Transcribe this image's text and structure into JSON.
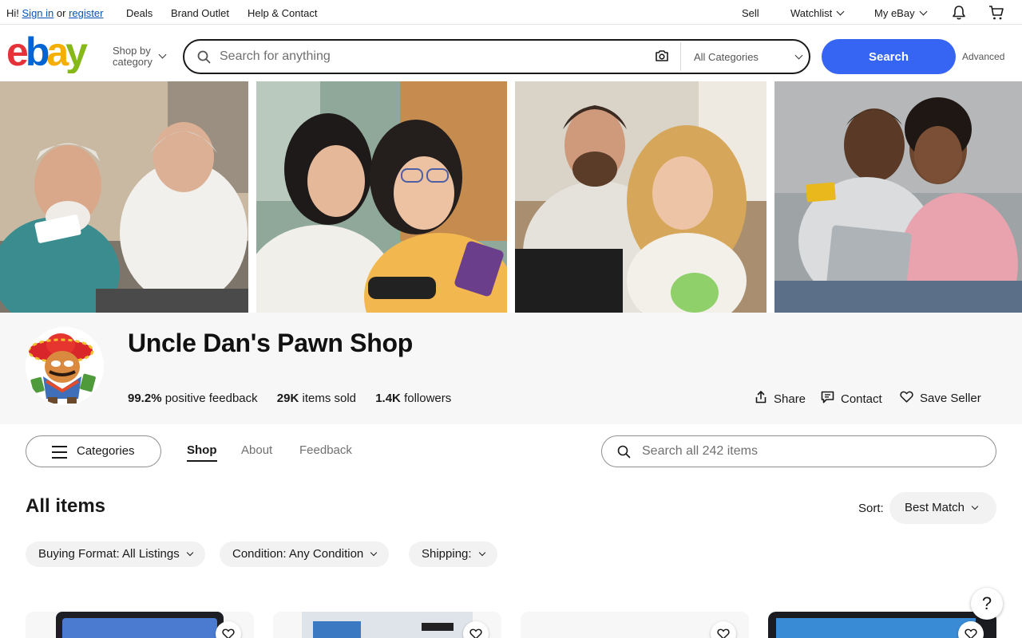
{
  "topbar": {
    "greeting": "Hi!",
    "sign_in": "Sign in",
    "or": "or",
    "register": "register",
    "deals": "Deals",
    "brand_outlet": "Brand Outlet",
    "help_contact": "Help & Contact",
    "sell": "Sell",
    "watchlist": "Watchlist",
    "my_ebay": "My eBay"
  },
  "header": {
    "logo_text": "ebay",
    "shop_by_line1": "Shop by",
    "shop_by_line2": "category",
    "search_placeholder": "Search for anything",
    "category_select": "All Categories",
    "search_button": "Search",
    "advanced": "Advanced"
  },
  "icons": {
    "search": "search-icon",
    "camera": "camera-icon",
    "bell": "bell-icon",
    "cart": "cart-icon",
    "share": "share-icon",
    "contact": "message-icon",
    "save": "heart-icon",
    "help": "help-icon"
  },
  "colors": {
    "ebay_red": "#e53238",
    "ebay_blue": "#0064d2",
    "ebay_yellow": "#f5af02",
    "ebay_green": "#86b817",
    "search_button": "#3665f3",
    "link": "#0654ba"
  },
  "store": {
    "name": "Uncle Dan's Pawn Shop",
    "feedback_value": "99.2%",
    "feedback_label": "positive feedback",
    "sold_value": "29K",
    "sold_label": "items sold",
    "followers_value": "1.4K",
    "followers_label": "followers",
    "share": "Share",
    "contact": "Contact",
    "save_seller": "Save Seller"
  },
  "store_nav": {
    "categories": "Categories",
    "tabs": [
      {
        "label": "Shop",
        "active": true
      },
      {
        "label": "About",
        "active": false
      },
      {
        "label": "Feedback",
        "active": false
      }
    ],
    "search_placeholder": "Search all 242 items"
  },
  "listing": {
    "heading": "All items",
    "sort_label": "Sort:",
    "sort_value": "Best Match",
    "filters": [
      "Buying Format: All Listings",
      "Condition: Any Condition",
      "Shipping:"
    ]
  },
  "help_label": "?"
}
